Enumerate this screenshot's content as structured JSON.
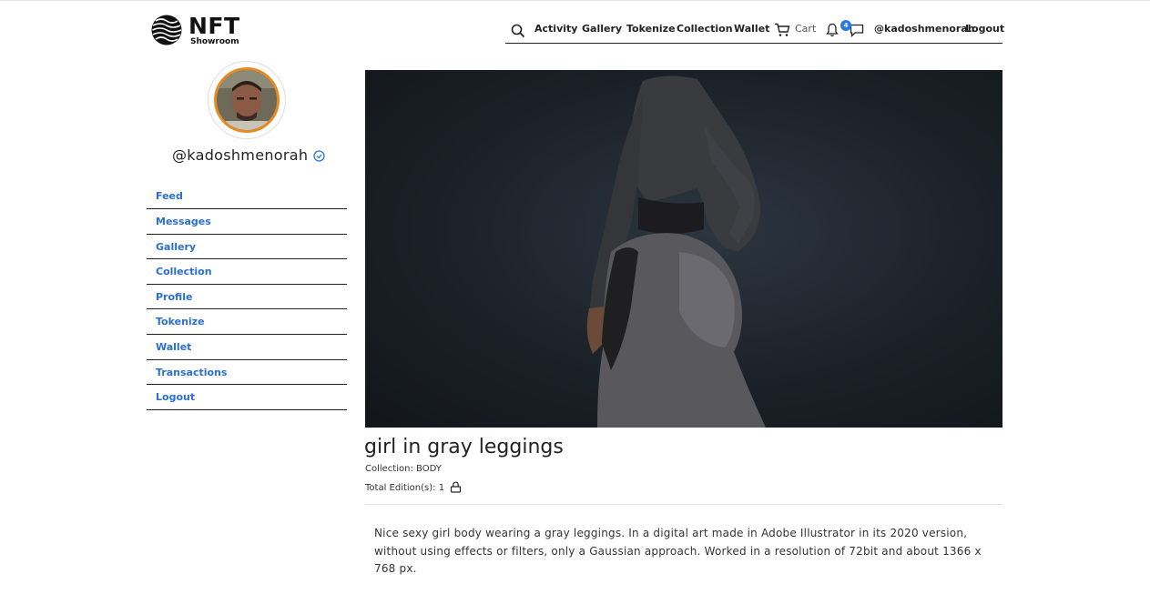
{
  "logo": {
    "big": "NFT",
    "small": "Showroom"
  },
  "topnav": {
    "activity": "Activity",
    "gallery": "Gallery",
    "tokenize": "Tokenize",
    "collection": "Collection",
    "wallet": "Wallet",
    "cart": "Cart",
    "notification_count": "4",
    "user": "@kadoshmenorah",
    "logout": "Logout"
  },
  "profile": {
    "username": "@kadoshmenorah",
    "verified_color": "#2a7ae4",
    "avatar_ring_color": "#e88a22"
  },
  "sidebar": {
    "items": [
      {
        "label": "Feed"
      },
      {
        "label": "Messages"
      },
      {
        "label": "Gallery"
      },
      {
        "label": "Collection"
      },
      {
        "label": "Profile"
      },
      {
        "label": "Tokenize"
      },
      {
        "label": "Wallet"
      },
      {
        "label": "Transactions"
      },
      {
        "label": "Logout"
      }
    ]
  },
  "artwork": {
    "title": "girl in gray leggings",
    "collection_label": "Collection: BODY",
    "editions_label": "Total Edition(s): 1",
    "description": "Nice sexy girl body wearing a gray leggings. In a digital art made in Adobe Illustrator in its 2020 version, without using effects or filters, only a Gaussian approach. Worked in a resolution of 72bit and about 1366 x 768 px."
  },
  "colors": {
    "link": "#2a6fcf",
    "badge": "#2a7ae4"
  }
}
